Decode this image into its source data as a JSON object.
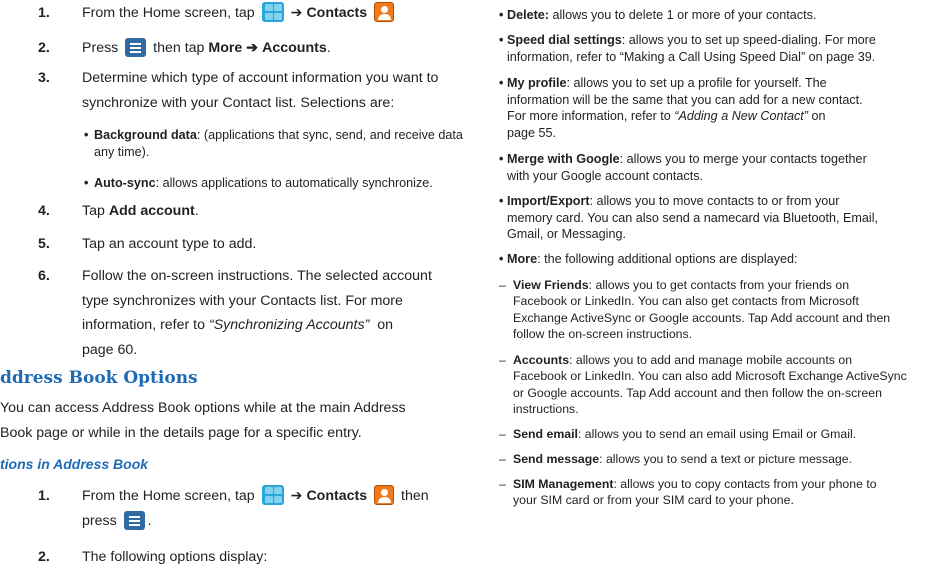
{
  "left": {
    "step1": {
      "num": "1.",
      "pre": "From the Home screen, tap",
      "arrow": "➔",
      "contacts": "Contacts"
    },
    "step2": {
      "num": "2.",
      "press": "Press",
      "then_tap": "then tap",
      "more": "More",
      "arrow": "➔",
      "accounts": "Accounts",
      "end": "."
    },
    "step3": {
      "num": "3.",
      "line1": "Determine which type of account information you want to",
      "line2": "synchronize with your Contact list. Selections are:"
    },
    "bullet_bg": {
      "label": "Background data",
      "text1": ": (applications that sync, send, and receive data",
      "text2": "any time)."
    },
    "bullet_sync": {
      "label": "Auto-sync",
      "text": ": allows applications to automatically synchronize."
    },
    "step4": {
      "num": "4.",
      "pre": "Tap",
      "label": "Add account",
      "end": "."
    },
    "step5": {
      "num": "5.",
      "text": "Tap an account type to add."
    },
    "step6": {
      "num": "6.",
      "line1": "Follow the on-screen instructions. The selected account",
      "line2": "type synchronizes with your Contacts list. For more",
      "line3_pre": "information, refer to",
      "line3_ref": "“Synchronizing Accounts”",
      "line3_post": "on",
      "line4": "page 60."
    },
    "heading": "ddress Book Options",
    "para1": "You can access Address Book options while at the main Address",
    "para2": "Book page or while in the details page for a specific entry.",
    "subhead": "tions in Address Book",
    "opt1": {
      "num": "1.",
      "pre": "From the Home screen, tap",
      "arrow": "➔",
      "contacts": "Contacts",
      "then": "then",
      "press": "press",
      "end": "."
    },
    "opt2": {
      "num": "2.",
      "text": "The following options display:"
    }
  },
  "right": {
    "delete": {
      "label": "Delete:",
      "text": " allows you to delete 1 or more of your contacts."
    },
    "speed": {
      "label": "Speed dial settings",
      "text1": ": allows you to set up speed-dialing. For more",
      "text2": "information, refer to “Making a Call Using Speed Dial”  on page 39."
    },
    "profile": {
      "label": "My profile",
      "text1": ": allows you to set up a profile for yourself. The",
      "text2": "information will be the same that you can add for a new contact.",
      "text3_pre": "For more information, refer to ",
      "text3_ref": "“Adding a New Contact”",
      "text3_post": "  on",
      "text4": "page 55."
    },
    "merge": {
      "label": "Merge with Google",
      "text1": ": allows you to merge your contacts together",
      "text2": "with your Google account contacts."
    },
    "import": {
      "label": "Import/Export",
      "text1": ": allows you to move contacts to or from your",
      "text2": "memory card. You can also send a namecard via Bluetooth, Email,",
      "text3": "Gmail, or Messaging."
    },
    "more": {
      "label": "More",
      "text": ": the following additional options are displayed:"
    },
    "friends": {
      "label": "View Friends",
      "text1": ": allows you to get contacts from your friends on",
      "text2": "Facebook or LinkedIn. You can also get contacts from Microsoft",
      "text3": "Exchange ActiveSync or Google accounts. Tap Add account and then",
      "text4": "follow the on-screen instructions."
    },
    "accounts": {
      "label": "Accounts",
      "text1": ": allows you to add and manage mobile accounts on",
      "text2": "Facebook or LinkedIn. You can also add Microsoft Exchange ActiveSync",
      "text3": "or Google accounts. Tap Add account and then follow the on-screen",
      "text4": "instructions."
    },
    "email": {
      "label": "Send email",
      "text": ": allows you to send an email using Email or Gmail."
    },
    "message": {
      "label": "Send message",
      "text": ": allows you to send a text or picture message."
    },
    "sim": {
      "label": "SIM Management",
      "text1": ": allows you to copy contacts from your phone to",
      "text2": "your SIM card or from your SIM card to your phone."
    }
  },
  "icons": {
    "apps": "apps-grid-icon",
    "menu": "menu-key-icon",
    "contacts": "contacts-icon"
  },
  "colors": {
    "text": "#231f20",
    "heading": "#1e6ab4",
    "apps_icon": "#2aa5d8",
    "menu_icon": "#2f6aa3",
    "contacts_icon": "#f07b1e"
  }
}
